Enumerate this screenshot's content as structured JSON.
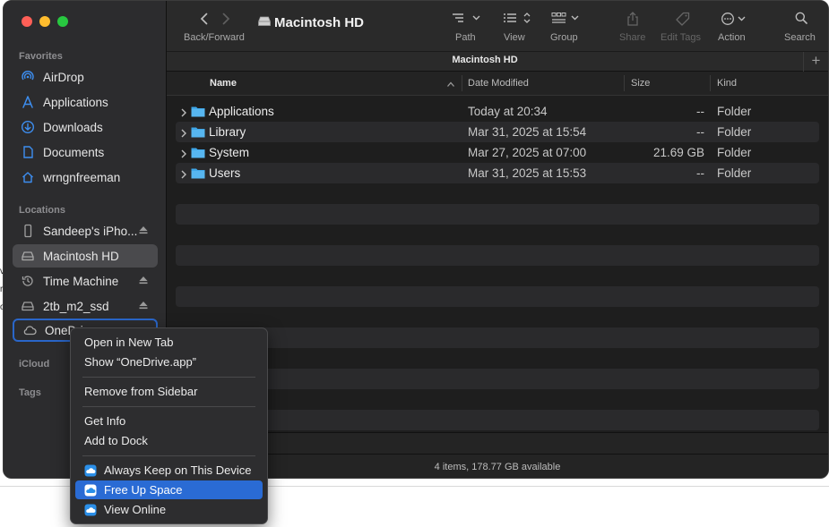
{
  "window": {
    "title": "Macintosh HD",
    "tab_title": "Macintosh HD"
  },
  "toolbar": {
    "back_forward_label": "Back/Forward",
    "path_label": "Path",
    "view_label": "View",
    "group_label": "Group",
    "share_label": "Share",
    "edit_tags_label": "Edit Tags",
    "action_label": "Action",
    "search_label": "Search"
  },
  "sidebar": {
    "favorites_header": "Favorites",
    "favorites": [
      {
        "label": "AirDrop",
        "icon": "airdrop-icon"
      },
      {
        "label": "Applications",
        "icon": "applications-icon"
      },
      {
        "label": "Downloads",
        "icon": "downloads-icon"
      },
      {
        "label": "Documents",
        "icon": "document-icon"
      },
      {
        "label": "wrngnfreeman",
        "icon": "home-icon"
      }
    ],
    "locations_header": "Locations",
    "locations": [
      {
        "label": "Sandeep's iPho...",
        "icon": "iphone-icon"
      },
      {
        "label": "Macintosh HD",
        "icon": "disk-icon"
      },
      {
        "label": "Time Machine",
        "icon": "time-machine-icon"
      },
      {
        "label": "2tb_m2_ssd",
        "icon": "disk-icon"
      },
      {
        "label": "OneDrive",
        "icon": "cloud-icon"
      }
    ],
    "icloud_header": "iCloud",
    "tags_header": "Tags"
  },
  "columns": {
    "name": "Name",
    "date": "Date Modified",
    "size": "Size",
    "kind": "Kind"
  },
  "files": [
    {
      "name": "Applications",
      "date": "Today at 20:34",
      "size": "--",
      "kind": "Folder"
    },
    {
      "name": "Library",
      "date": "Mar 31, 2025 at 15:54",
      "size": "--",
      "kind": "Folder"
    },
    {
      "name": "System",
      "date": "Mar 27, 2025 at 07:00",
      "size": "21.69 GB",
      "kind": "Folder"
    },
    {
      "name": "Users",
      "date": "Mar 31, 2025 at 15:53",
      "size": "--",
      "kind": "Folder"
    }
  ],
  "status": {
    "text": "4 items, 178.77 GB available"
  },
  "context_menu": {
    "items": [
      "Open in New Tab",
      "Show “OneDrive.app”",
      "Remove from Sidebar",
      "Get Info",
      "Add to Dock",
      "Always Keep on This Device",
      "Free Up Space",
      "View Online"
    ],
    "active_item": "Free Up Space"
  },
  "colors": {
    "accent": "#2a6bd4",
    "folder": "#3fa7e8",
    "sidebar_icon": "#3d8ef0"
  }
}
